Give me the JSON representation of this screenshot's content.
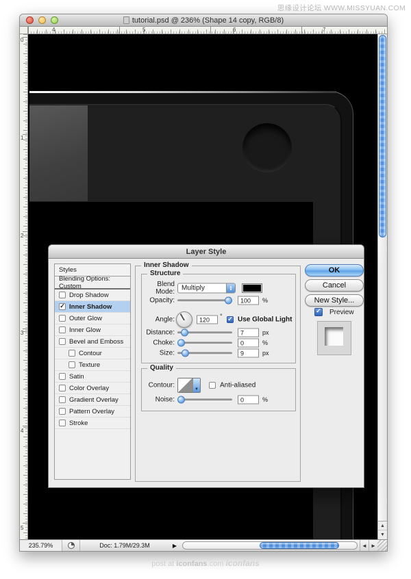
{
  "watermarks": {
    "top": "思缘设计论坛 WWW.MISSYUAN.COM",
    "bottom_prefix": "post at ",
    "bottom_site": "iconfans",
    "bottom_domain": ".com ",
    "bottom_logo": "iconfans"
  },
  "window": {
    "title": "tutorial.psd @ 236% (Shape 14 copy, RGB/8)",
    "rulers": {
      "h": [
        "4",
        "5",
        "6",
        "7"
      ],
      "v": [
        "0",
        "1",
        "2",
        "3",
        "4",
        "5"
      ]
    },
    "status_bar": {
      "zoom_level": "235.79%",
      "doc_info": "Doc: 1.79M/29.3M"
    }
  },
  "dialog": {
    "title": "Layer Style",
    "sidebar": {
      "header": "Styles",
      "blending_row": "Blending Options: Custom",
      "items": [
        {
          "label": "Drop Shadow"
        },
        {
          "label": "Inner Shadow"
        },
        {
          "label": "Outer Glow"
        },
        {
          "label": "Inner Glow"
        },
        {
          "label": "Bevel and Emboss"
        },
        {
          "label": "Contour"
        },
        {
          "label": "Texture"
        },
        {
          "label": "Satin"
        },
        {
          "label": "Color Overlay"
        },
        {
          "label": "Gradient Overlay"
        },
        {
          "label": "Pattern Overlay"
        },
        {
          "label": "Stroke"
        }
      ],
      "selected_item": "Inner Shadow",
      "selected_color": "#b3d0f0"
    },
    "panel": {
      "title": "Inner Shadow",
      "structure": {
        "title": "Structure",
        "blend_mode_label": "Blend Mode:",
        "blend_mode_value": "Multiply",
        "shadow_color": "#000000",
        "opacity_label": "Opacity:",
        "opacity_value": "100",
        "opacity_unit": "%",
        "angle_label": "Angle:",
        "angle_value": "120",
        "angle_unit": "°",
        "use_global_light_label": "Use Global Light",
        "distance_label": "Distance:",
        "distance_value": "7",
        "distance_unit": "px",
        "choke_label": "Choke:",
        "choke_value": "0",
        "choke_unit": "%",
        "size_label": "Size:",
        "size_value": "9",
        "size_unit": "px"
      },
      "quality": {
        "title": "Quality",
        "contour_label": "Contour:",
        "anti_aliased_label": "Anti-aliased",
        "noise_label": "Noise:",
        "noise_value": "0",
        "noise_unit": "%"
      }
    },
    "actions": {
      "ok": "OK",
      "cancel": "Cancel",
      "new_style": "New Style...",
      "preview": "Preview"
    }
  }
}
